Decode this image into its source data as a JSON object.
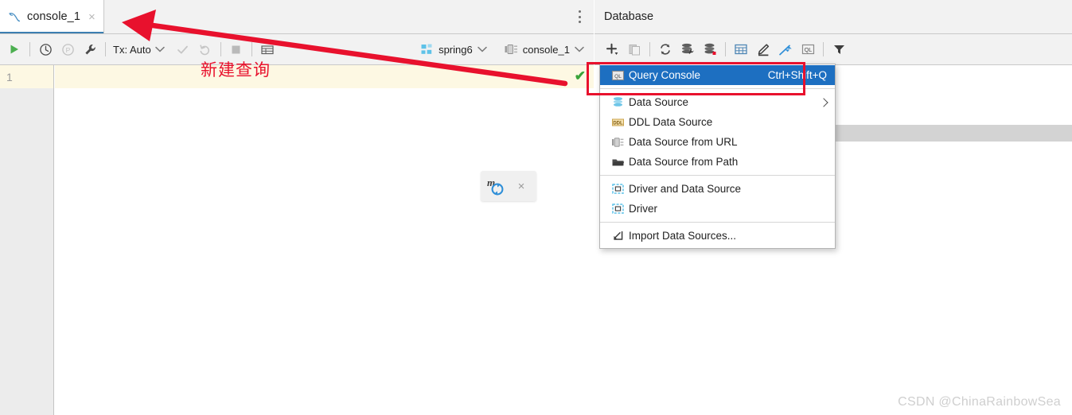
{
  "editor": {
    "tab": {
      "label": "console_1",
      "icon": "mysql-dolphin-icon",
      "close": "×"
    },
    "kebab_title": "More options",
    "toolbar": {
      "run_icon": "run-play-icon",
      "history_icon": "clock-history-icon",
      "profile_icon": "profile-p-icon",
      "settings_icon": "wrench-icon",
      "tx_label": "Tx: Auto",
      "commit_icon": "commit-check-icon",
      "rollback_icon": "rollback-undo-icon",
      "stop_icon": "stop-square-icon",
      "table_icon": "output-table-icon",
      "schema_chip": "spring6",
      "schema_icon": "schema-icon",
      "console_chip": "console_1",
      "console_icon": "console-chip-icon"
    },
    "gutter": {
      "line_numbers": [
        "1"
      ]
    },
    "inspection_badge": "✔",
    "floating_chip": {
      "icon": "mysql-refresh-icon",
      "close": "×"
    }
  },
  "database": {
    "title": "Database",
    "toolbar_icons": [
      "add-plus-icon",
      "duplicate-icon",
      "refresh-icon",
      "run-configuration-icon",
      "database-stack-icon",
      "table-grid-icon",
      "edit-pencil-icon",
      "jump-to-source-icon",
      "ql-console-icon",
      "filter-funnel-icon"
    ],
    "popup": {
      "items": [
        {
          "label": "Query Console",
          "shortcut": "Ctrl+Shift+Q",
          "icon": "ql-console-icon",
          "selected": true,
          "submenu": false,
          "separator_after": true
        },
        {
          "label": "Data Source",
          "shortcut": "",
          "icon": "data-source-icon",
          "selected": false,
          "submenu": true,
          "separator_after": false
        },
        {
          "label": "DDL Data Source",
          "shortcut": "",
          "icon": "ddl-data-source-icon",
          "selected": false,
          "submenu": false,
          "separator_after": false
        },
        {
          "label": "Data Source from URL",
          "shortcut": "",
          "icon": "data-source-url-icon",
          "selected": false,
          "submenu": false,
          "separator_after": false
        },
        {
          "label": "Data Source from Path",
          "shortcut": "",
          "icon": "data-source-path-icon",
          "selected": false,
          "submenu": false,
          "separator_after": true
        },
        {
          "label": "Driver and Data Source",
          "shortcut": "",
          "icon": "driver-icon",
          "selected": false,
          "submenu": false,
          "separator_after": false
        },
        {
          "label": "Driver",
          "shortcut": "",
          "icon": "driver-icon",
          "selected": false,
          "submenu": false,
          "separator_after": true
        },
        {
          "label": "Import Data Sources...",
          "shortcut": "",
          "icon": "import-data-sources-icon",
          "selected": false,
          "submenu": false,
          "separator_after": false
        }
      ]
    }
  },
  "annotations": {
    "note_text": "新建查询",
    "accent_color": "#e8112d",
    "highlight_color": "#1d6fc1"
  },
  "watermark": "CSDN @ChinaRainbowSea"
}
